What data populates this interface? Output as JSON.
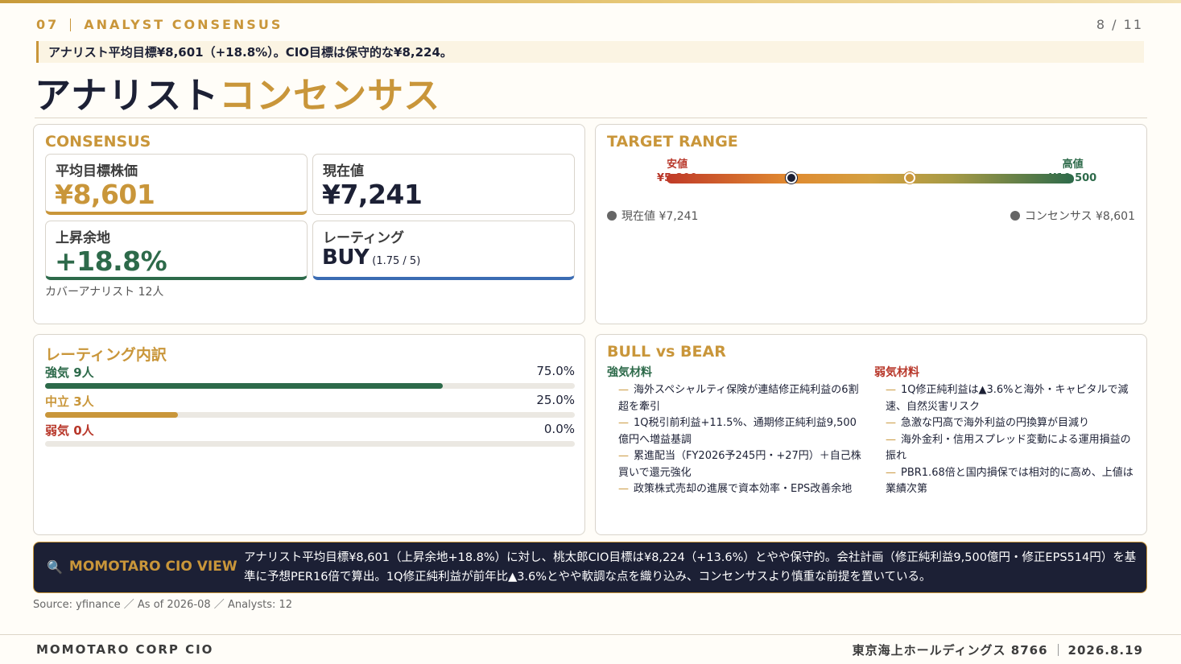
{
  "header": {
    "section_number": "07",
    "section_label": "ANALYST CONSENSUS",
    "page": "8 / 11",
    "lead": "アナリスト平均目標¥8,601（+18.8%）。CIO目標は保守的な¥8,224。",
    "title_main": "アナリスト",
    "title_accent": "コンセンサス"
  },
  "consensus": {
    "title": "CONSENSUS",
    "avg_target_label": "平均目標株価",
    "avg_target_value": "¥8,601",
    "current_label": "現在値",
    "current_value": "¥7,241",
    "upside_label": "上昇余地",
    "upside_value": "+18.8%",
    "rating_label": "レーティング",
    "rating_value": "BUY",
    "rating_score": "(1.75 / 5)",
    "coverage": "カバーアナリスト 12人"
  },
  "target_range": {
    "title": "TARGET RANGE",
    "low_label": "安値",
    "low_value": "¥5,800",
    "high_label": "高値",
    "high_value": "¥10,500",
    "low": 5800,
    "high": 10500,
    "current": 7241,
    "consensus": 8601,
    "legend_current": "現在値 ¥7,241",
    "legend_consensus": "コンセンサス ¥8,601",
    "colors": {
      "current": "#1c2035",
      "consensus": "#c9963a"
    }
  },
  "rating_breakdown": {
    "title": "レーティング内訳",
    "rows": [
      {
        "label": "強気 9人",
        "pct_text": "75.0%",
        "pct": 75.0,
        "color": "#2d6a4a"
      },
      {
        "label": "中立 3人",
        "pct_text": "25.0%",
        "pct": 25.0,
        "color": "#c9963a"
      },
      {
        "label": "弱気 0人",
        "pct_text": "0.0%",
        "pct": 0.0,
        "color": "#b8372a"
      }
    ]
  },
  "bull_bear": {
    "title": "BULL vs BEAR",
    "bull_title": "強気材料",
    "bull": [
      "海外スペシャルティ保険が連結修正純利益の6割超を牽引",
      "1Q税引前利益+11.5%、通期修正純利益9,500億円へ増益基調",
      "累進配当（FY2026予245円・+27円）＋自己株買いで還元強化",
      "政策株式売却の進展で資本効率・EPS改善余地"
    ],
    "bear_title": "弱気材料",
    "bear": [
      "1Q修正純利益は▲3.6%と海外・キャピタルで減速、自然災害リスク",
      "急激な円高で海外利益の円換算が目減り",
      "海外金利・信用スプレッド変動による運用損益の振れ",
      "PBR1.68倍と国内損保では相対的に高め、上値は業績次第"
    ],
    "dash": "—"
  },
  "cio_view": {
    "icon": "magnifier-icon",
    "label": "MOMOTARO CIO VIEW",
    "text": "アナリスト平均目標¥8,601（上昇余地+18.8%）に対し、桃太郎CIO目標は¥8,224（+13.6%）とやや保守的。会社計画（修正純利益9,500億円・修正EPS514円）を基準に予想PER16倍で算出。1Q修正純利益が前年比▲3.6%とやや軟調な点を織り込み、コンセンサスより慎重な前提を置いている。"
  },
  "source": "Source: yfinance ／ As of 2026-08 ／ Analysts: 12",
  "footer": {
    "left": "MOMOTARO CORP CIO",
    "company": "東京海上ホールディングス 8766",
    "date": "2026.8.19"
  }
}
